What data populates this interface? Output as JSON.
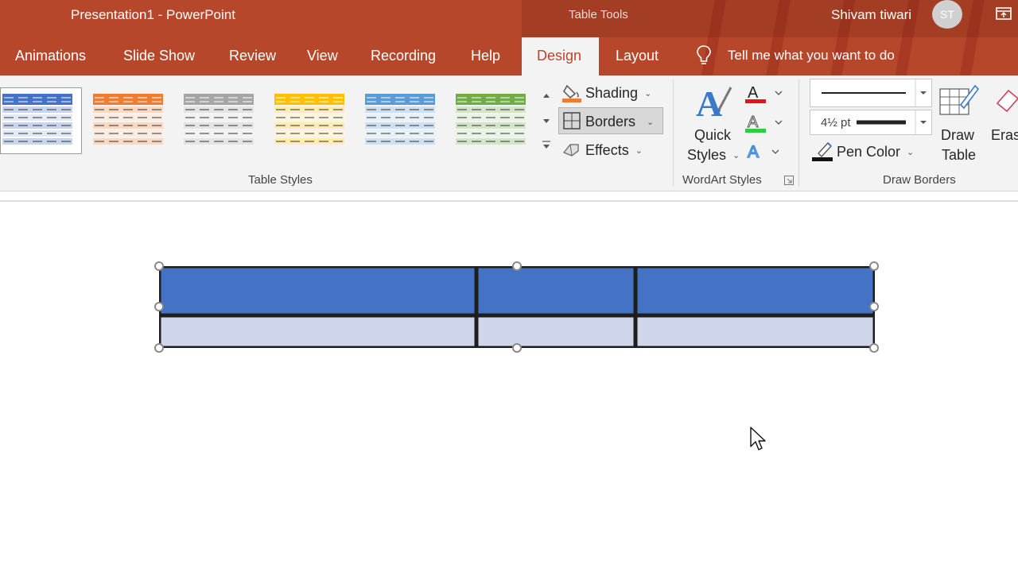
{
  "titlebar": {
    "doc_title": "Presentation1  -  PowerPoint",
    "context_title": "Table Tools",
    "user_name": "Shivam tiwari",
    "user_initials": "ST"
  },
  "tabs": [
    "Animations",
    "Slide Show",
    "Review",
    "View",
    "Recording",
    "Help",
    "Design",
    "Layout"
  ],
  "tell_me": "Tell me what you want to do",
  "table_styles": {
    "group_label": "Table Styles",
    "colors": [
      "#4472c4",
      "#ed7d31",
      "#a5a5a5",
      "#ffc000",
      "#5b9bd5",
      "#70ad47"
    ]
  },
  "shading": {
    "shading_label": "Shading",
    "borders_label": "Borders",
    "effects_label": "Effects"
  },
  "wordart": {
    "quick_label": "Quick",
    "styles_label": "Styles",
    "group_label": "WordArt Styles",
    "text_fill_color": "#e81123",
    "text_outline_color": "#2ecc40",
    "text_effect_color": "#4a90d9"
  },
  "draw_borders": {
    "pen_weight": "4½ pt",
    "pen_color_label": "Pen Color",
    "draw_label": "Draw",
    "table_label": "Table",
    "eraser_label": "Eras",
    "group_label": "Draw Borders"
  },
  "slide_table": {
    "header_color": "#4472c4",
    "body_color": "#cfd5ea",
    "border_color": "#1e1e1e"
  }
}
